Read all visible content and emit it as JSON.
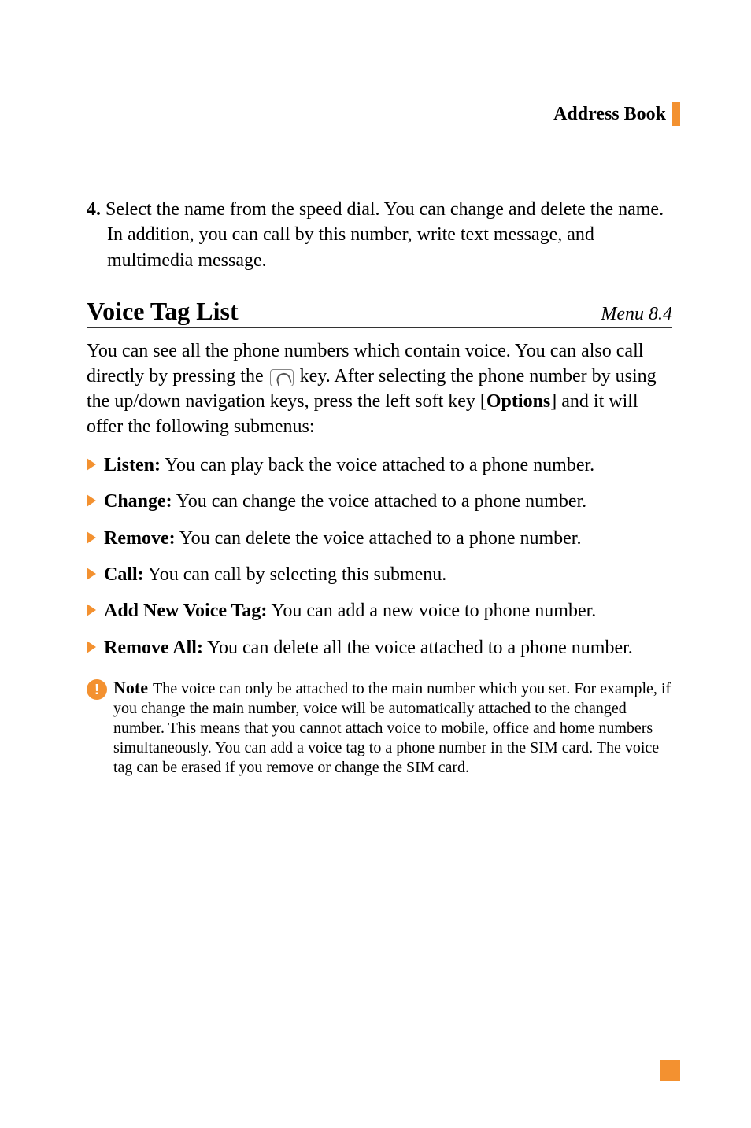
{
  "header": {
    "title": "Address Book"
  },
  "step4": {
    "num": "4.",
    "text": " Select the name from the speed dial. You can change and delete the name. In addition, you can call by this number, write text message, and multimedia message."
  },
  "section": {
    "heading": "Voice Tag List",
    "menuRef": "Menu 8.4"
  },
  "intro": {
    "part1": "You can see all the phone numbers which contain voice. You can also call directly by pressing the ",
    "part2": " key. After selecting the phone number by using the up/down navigation keys, press the left soft key [",
    "optionsLabel": "Options",
    "part3": "] and it will offer the following submenus:"
  },
  "bullets": [
    {
      "label": "Listen:",
      "desc": " You can play back the voice attached to a phone number."
    },
    {
      "label": "Change:",
      "desc": " You can change the voice attached to a phone number."
    },
    {
      "label": "Remove:",
      "desc": " You can delete the voice attached to a phone number."
    },
    {
      "label": "Call:",
      "desc": " You can call by selecting this submenu."
    },
    {
      "label": "Add New Voice Tag:",
      "desc": " You can add a new voice to phone number."
    },
    {
      "label": "Remove All:",
      "desc": " You can delete all the voice attached to a phone number."
    }
  ],
  "note": {
    "iconGlyph": "!",
    "label": "Note",
    "body": "The voice can only be attached to the main number which you set. For example, if you change the main number, voice will be automatically attached to the changed number. This means that you cannot attach voice to mobile, office and home numbers simultaneously. You can add a voice tag to a phone number in the SIM card. The voice tag can be erased if you remove or change the SIM card."
  }
}
